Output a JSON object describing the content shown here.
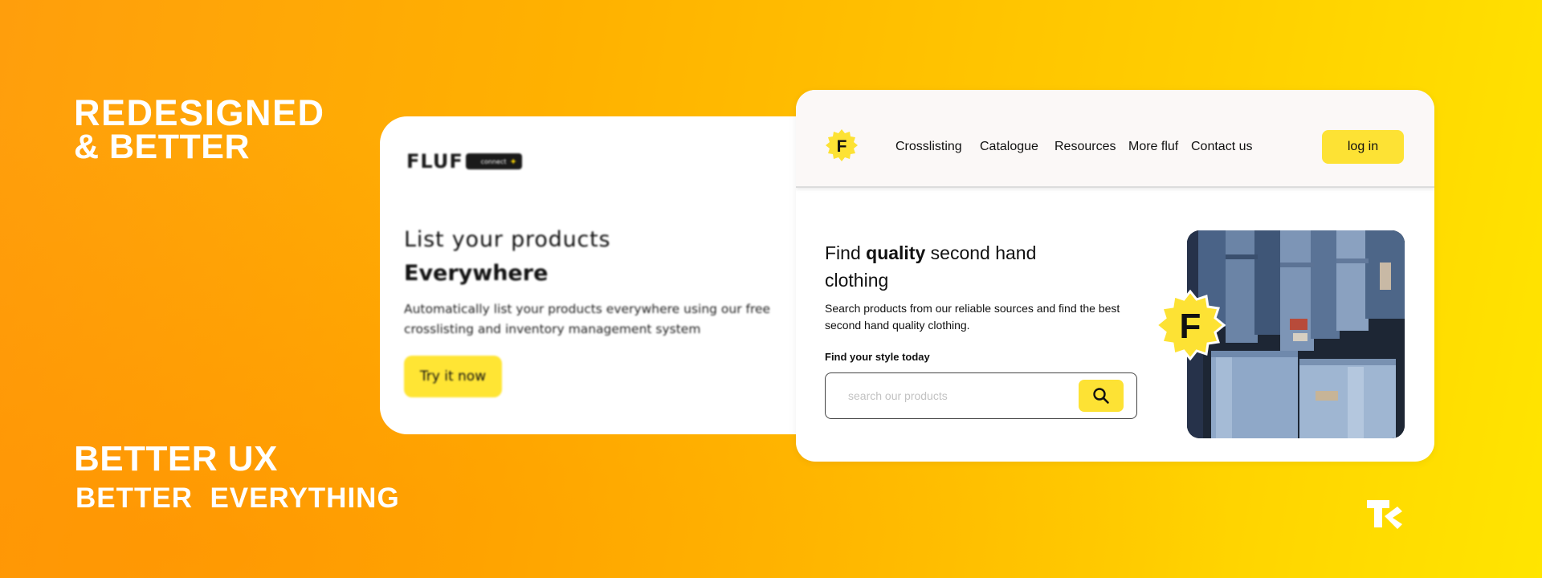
{
  "promo": {
    "headline_1": "REDESIGNED",
    "headline_2": "& BETTER",
    "headline_3": "BETTER UX",
    "headline_4": "BETTER  EVERYTHING"
  },
  "old_site": {
    "logo_text": "FLUF",
    "logo_pill_text": "connect",
    "title_line_1": "List your products",
    "title_line_2": "Everywhere",
    "description": "Automatically list your products everywhere using our free crosslisting and inventory management system",
    "cta_label": "Try it now"
  },
  "new_site": {
    "logo_letter": "F",
    "nav": [
      "Crosslisting",
      "Catalogue",
      "Resources",
      "More fluf",
      "Contact us"
    ],
    "login_label": "log in",
    "hero_title_prefix": "Find ",
    "hero_title_bold": "quality",
    "hero_title_suffix": " second hand clothing",
    "hero_description": "Search products from our reliable sources and find the best second hand quality clothing.",
    "search_label": "Find your style today",
    "search_placeholder": "search our products",
    "badge_letter": "F"
  },
  "colors": {
    "accent_yellow": "#fde234",
    "background_orange": "#ffa40a",
    "background_yellow": "#ffe500"
  },
  "icons": {
    "search": "search-icon",
    "brand": "brand-mark-icon"
  }
}
